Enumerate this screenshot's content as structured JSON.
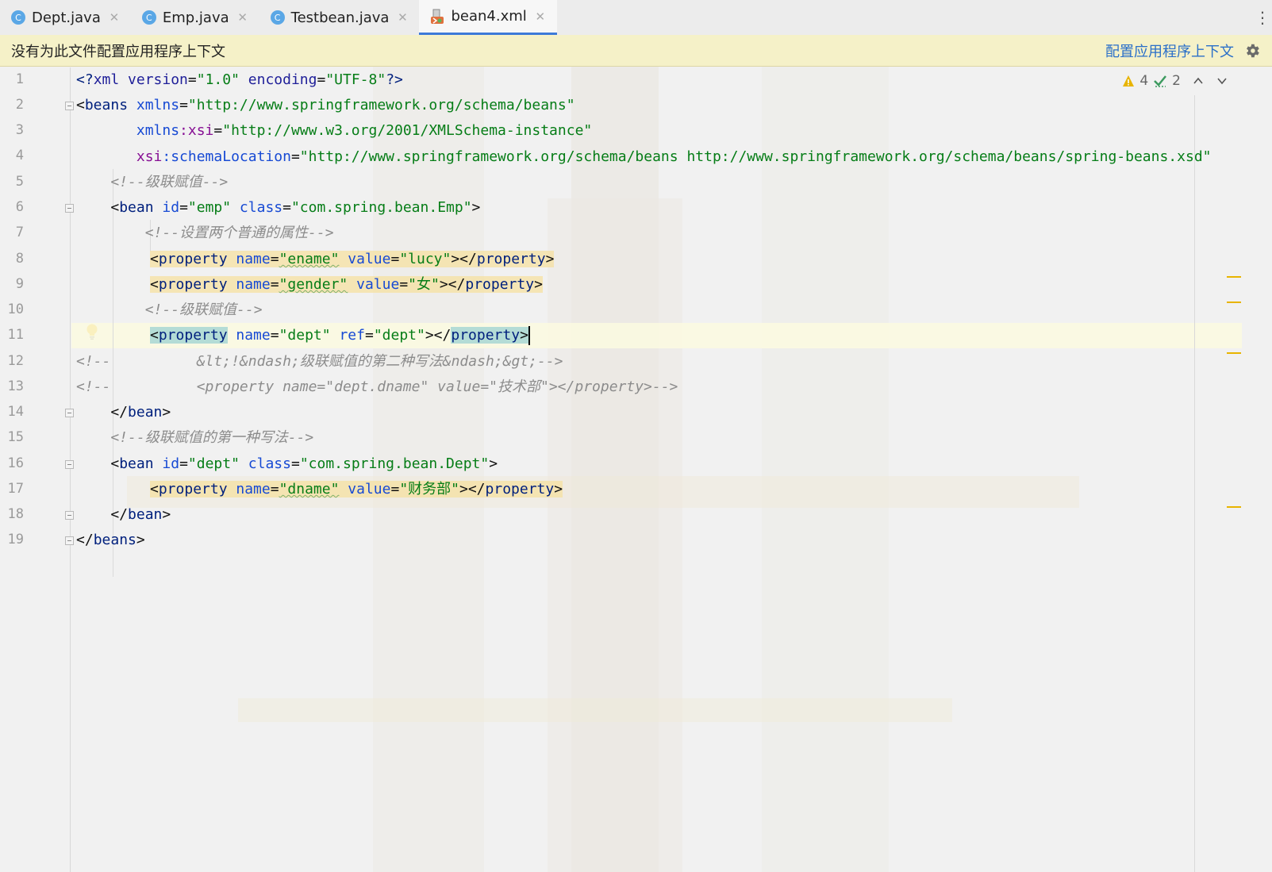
{
  "tabs": [
    {
      "label": "Dept.java",
      "icon": "java-class-icon",
      "active": false
    },
    {
      "label": "Emp.java",
      "icon": "java-class-icon",
      "active": false
    },
    {
      "label": "Testbean.java",
      "icon": "java-class-icon",
      "active": false
    },
    {
      "label": "bean4.xml",
      "icon": "xml-file-icon",
      "active": true
    }
  ],
  "tab_icon_letter": "C",
  "banner": {
    "message": "没有为此文件配置应用程序上下文",
    "action": "配置应用程序上下文"
  },
  "inspections": {
    "warnings": "4",
    "weak_warnings": "2"
  },
  "line_numbers": [
    "1",
    "2",
    "3",
    "4",
    "5",
    "6",
    "7",
    "8",
    "9",
    "10",
    "11",
    "12",
    "13",
    "14",
    "15",
    "16",
    "17",
    "18",
    "19"
  ],
  "code": {
    "l1": {
      "a": "<?",
      "b": "xml version",
      "c": "=",
      "d": "\"1.0\"",
      "e": " encoding",
      "f": "=",
      "g": "\"UTF-8\"",
      "h": "?>"
    },
    "l2": {
      "a": "<",
      "b": "beans",
      "c": " xmlns",
      "d": "=",
      "e": "\"http://www.springframework.org/schema/beans\""
    },
    "l3": {
      "a": "       xmlns",
      "b": ":xsi",
      "c": "=",
      "d": "\"http://www.w3.org/2001/XMLSchema-instance\""
    },
    "l4": {
      "a": "       xsi",
      "b": ":schemaLocation",
      "c": "=",
      "d": "\"http://www.springframework.org/schema/beans http://www.springframework.org/schema/beans/spring-beans.xsd\""
    },
    "l5": {
      "a": "    <!--级联赋值-->"
    },
    "l6": {
      "a": "    <",
      "b": "bean",
      "c": " id",
      "d": "=",
      "e": "\"emp\"",
      "f": " class",
      "g": "=",
      "h": "\"com.spring.bean.Emp\"",
      "i": ">"
    },
    "l7": {
      "a": "        <!--设置两个普通的属性-->"
    },
    "l8": {
      "a": "<",
      "b": "property",
      "c": " name",
      "d": "=",
      "e": "\"ename\"",
      "f": " value",
      "g": "=",
      "h": "\"lucy\"",
      "i": "></",
      "j": "property",
      "k": ">"
    },
    "l9": {
      "a": "<",
      "b": "property",
      "c": " name",
      "d": "=",
      "e": "\"gender\"",
      "f": " value",
      "g": "=",
      "h": "\"女\"",
      "i": "></",
      "j": "property",
      "k": ">"
    },
    "l10": {
      "a": "        <!--级联赋值-->"
    },
    "l11": {
      "a": "<",
      "b": "property",
      "c": " name",
      "d": "=",
      "e": "\"dept\"",
      "f": " ref",
      "g": "=",
      "h": "\"dept\"",
      "i": "></",
      "j": "property",
      "k": ">"
    },
    "l12": {
      "a": "<!--          &lt;!&ndash;级联赋值的第二种写法&ndash;&gt;-->"
    },
    "l13": {
      "a": "<!--          <property name=\"dept.dname\" value=\"技术部\"></property>-->"
    },
    "l14": {
      "a": "    </",
      "b": "bean",
      "c": ">"
    },
    "l15": {
      "a": "    <!--级联赋值的第一种写法-->"
    },
    "l16": {
      "a": "    <",
      "b": "bean",
      "c": " id",
      "d": "=",
      "e": "\"dept\"",
      "f": " class",
      "g": "=",
      "h": "\"com.spring.bean.Dept\"",
      "i": ">"
    },
    "l17": {
      "a": "<",
      "b": "property",
      "c": " name",
      "d": "=",
      "e": "\"dname\"",
      "f": " value",
      "g": "=",
      "h": "\"财务部\"",
      "i": "></",
      "j": "property",
      "k": ">"
    },
    "l18": {
      "a": "    </",
      "b": "bean",
      "c": ">"
    },
    "l19": {
      "a": "</",
      "b": "beans",
      "c": ">"
    }
  },
  "colors": {
    "tag": "#00207d",
    "attr": "#174ad4",
    "value": "#067d17",
    "comment": "#8c8c8c",
    "namespace": "#871094",
    "active_tab_underline": "#3d7ad8",
    "banner_bg": "#f5f1c8",
    "link": "#2a6fc9",
    "warning": "#e8b400"
  }
}
